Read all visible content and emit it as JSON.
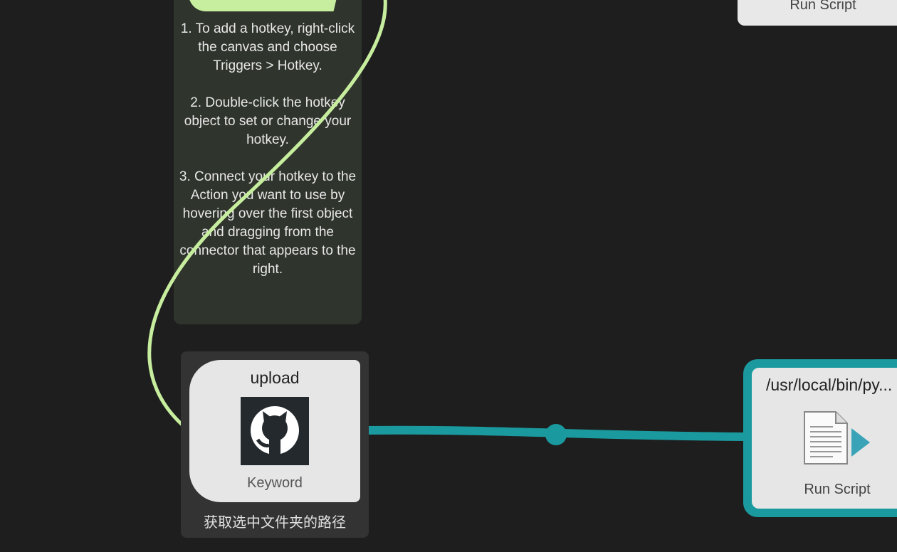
{
  "note": {
    "text": "1. To add a hotkey, right-click the canvas and choose Triggers > Hotkey.\n\n2. Double-click the hotkey object to set or change your hotkey.\n\n3. Connect your hotkey to the Action you want to use by hovering over the first object and dragging from the connector that appears to the right."
  },
  "top_card": {
    "label": "Run Script"
  },
  "keyword_node": {
    "title": "upload",
    "icon": "github-icon",
    "type_label": "Keyword",
    "subtext": "获取选中文件夹的路径"
  },
  "run_script_node": {
    "title": "/usr/local/bin/py...",
    "icon": "script-document-icon",
    "type_label": "Run Script"
  },
  "colors": {
    "canvas": "#1e1e1e",
    "note_bg": "#2f342c",
    "note_accent": "#c7ee9e",
    "hotkey_wire": "#c7ee9e",
    "action_wire": "#1a9a9e",
    "node_bg": "#e6e6e6"
  }
}
